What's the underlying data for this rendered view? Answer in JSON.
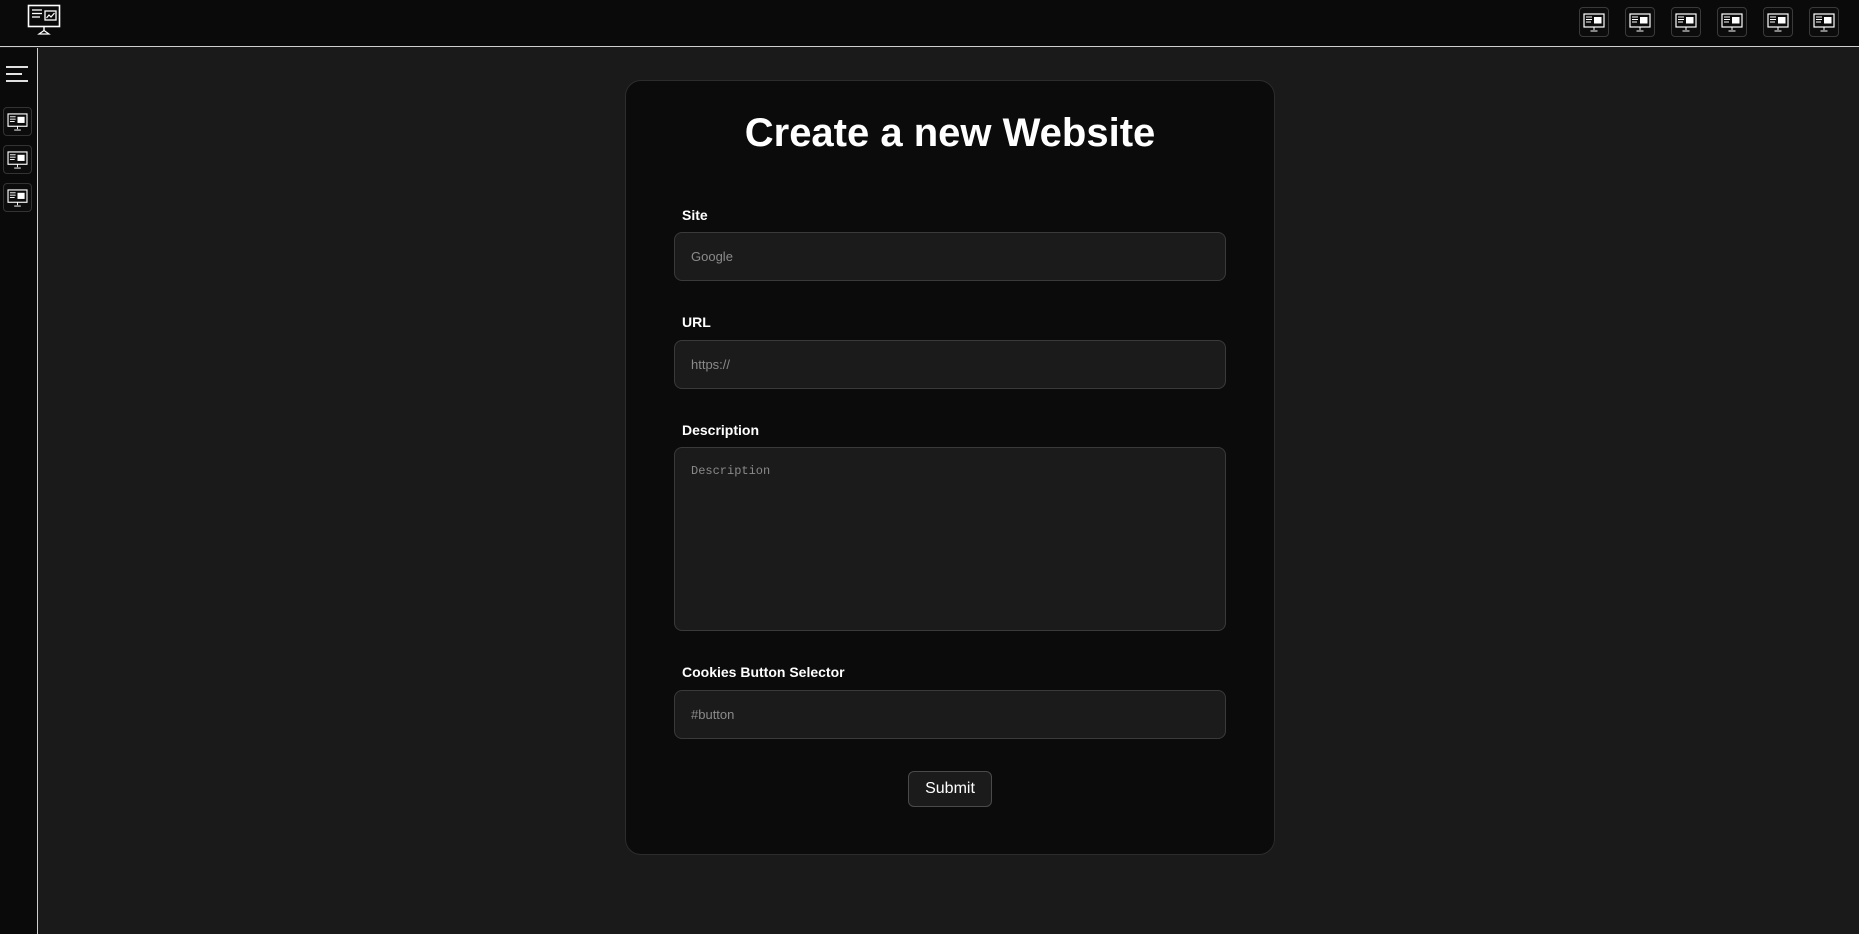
{
  "header": {
    "logo_icon": "monitor-chart-icon",
    "actions": [
      {
        "icon": "monitor-chart-icon"
      },
      {
        "icon": "monitor-chart-icon"
      },
      {
        "icon": "monitor-chart-icon"
      },
      {
        "icon": "monitor-chart-icon"
      },
      {
        "icon": "monitor-chart-icon"
      },
      {
        "icon": "monitor-chart-icon"
      }
    ]
  },
  "sidebar": {
    "toggle_icon": "hamburger-menu-icon",
    "items": [
      {
        "icon": "monitor-chart-icon"
      },
      {
        "icon": "monitor-chart-icon"
      },
      {
        "icon": "monitor-chart-icon"
      }
    ]
  },
  "form": {
    "title": "Create a new Website",
    "site": {
      "label": "Site",
      "placeholder": "Google",
      "value": ""
    },
    "url": {
      "label": "URL",
      "placeholder": "https://",
      "value": ""
    },
    "description": {
      "label": "Description",
      "placeholder": "Description",
      "value": ""
    },
    "cookies_selector": {
      "label": "Cookies Button Selector",
      "placeholder": "#button",
      "value": ""
    },
    "submit_label": "Submit"
  },
  "colors": {
    "page_bg": "#1a1a1a",
    "bar_bg": "#0a0a0a",
    "card_bg": "#0b0b0b",
    "input_bg": "#1b1b1b",
    "text": "#ffffff",
    "placeholder": "#8a8a8a"
  }
}
